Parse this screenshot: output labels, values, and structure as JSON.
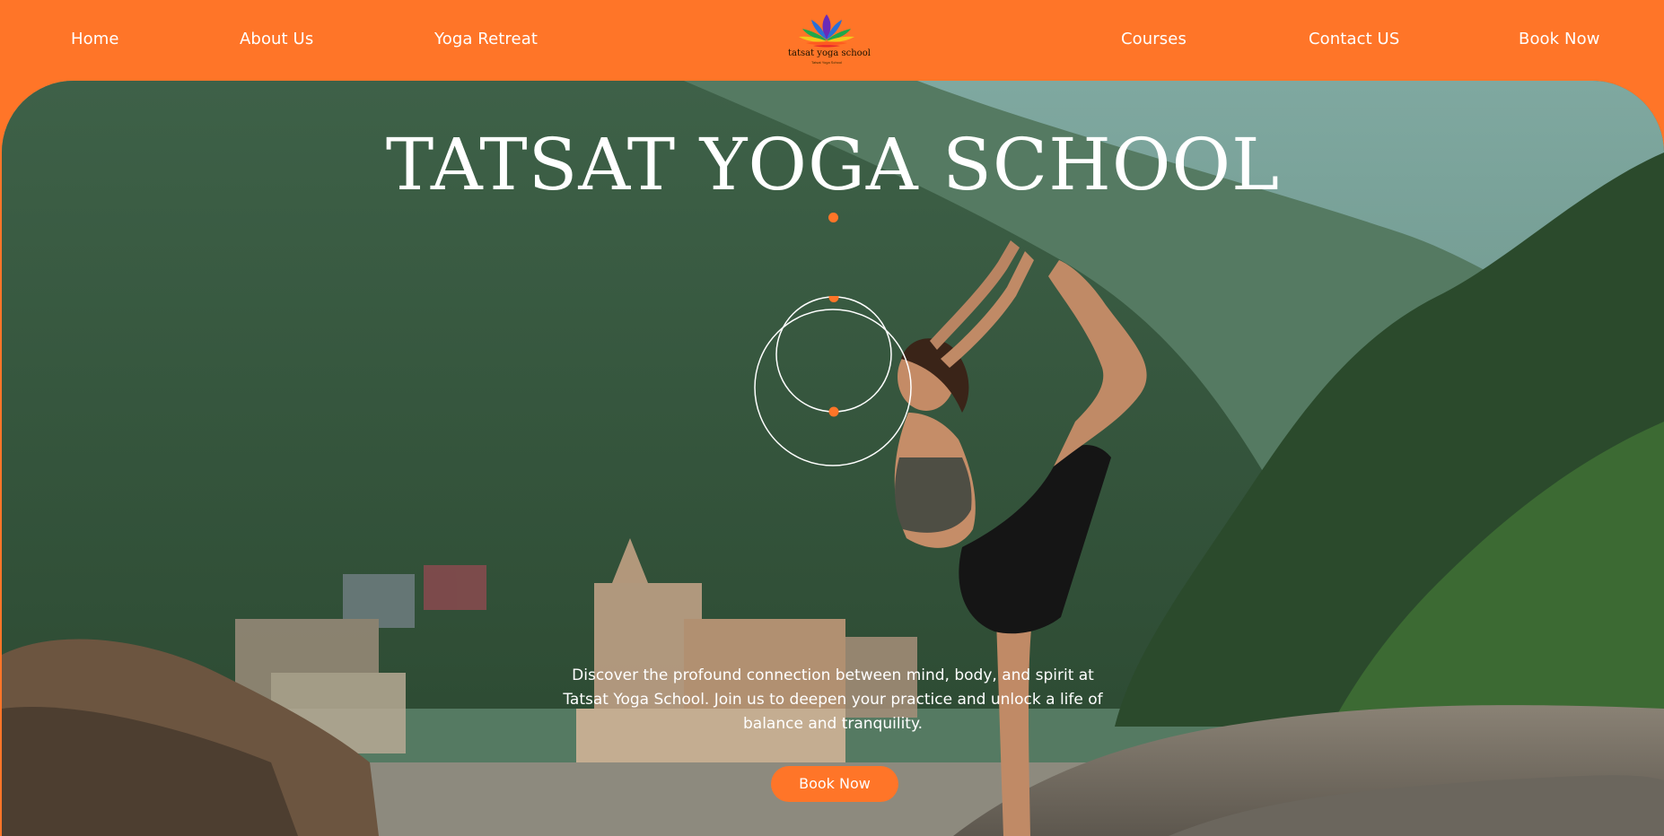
{
  "nav": {
    "home": "Home",
    "about": "About Us",
    "retreat": "Yoga Retreat",
    "courses": "Courses",
    "contact": "Contact US",
    "book": "Book Now"
  },
  "logo": {
    "name": "tatsat yoga school",
    "tagline": "Tatsat Yoga School",
    "icon": "lotus-icon"
  },
  "hero": {
    "title": "TATSAT YOGA SCHOOL",
    "description": "Discover the profound connection between mind, body, and spirit at Tatsat Yoga School. Join us to deepen your practice and unlock a life of balance and tranquility.",
    "button_label": "Book Now",
    "image": "yoga-pose-river-photo"
  },
  "colors": {
    "brand_orange": "#ff7528",
    "text_white": "#ffffff",
    "forest_green": "#3f5f45"
  }
}
